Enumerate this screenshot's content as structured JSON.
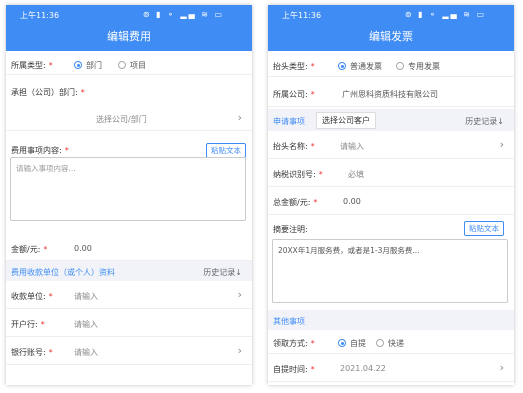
{
  "status_bar": {
    "time": "上午11:36",
    "glyphs": "⊚ ▮ ⚬ ▂▄ ≋ ▭"
  },
  "left": {
    "title": "编辑费用",
    "category": {
      "label": "所属类型:",
      "options": [
        "部门",
        "项目"
      ],
      "selected": "部门"
    },
    "dept": {
      "label": "承担（公司）部门:",
      "value": "选择公司/部门"
    },
    "cost_content": {
      "label": "费用事项内容:",
      "paste_button": "粘贴文本",
      "placeholder": "请输入事项内容..."
    },
    "amount": {
      "label": "金额/元:",
      "value": "0.00"
    },
    "section": {
      "title": "费用收款单位（或个人）资料",
      "history": "历史记录↓"
    },
    "payee": {
      "label": "收款单位:",
      "placeholder": "请输入"
    },
    "bank": {
      "label": "开户行:",
      "placeholder": "请输入"
    },
    "account": {
      "label": "银行账号:",
      "placeholder": "请输入"
    }
  },
  "right": {
    "title": "编辑发票",
    "header_type": {
      "label": "抬头类型:",
      "options": [
        "普通发票",
        "专用发票"
      ],
      "selected": "普通发票"
    },
    "company": {
      "label": "所属公司:",
      "value": "广州思科资质科技有限公司"
    },
    "tabs": [
      "申请事项",
      "选择公司客户"
    ],
    "history": "历史记录↓",
    "header_name": {
      "label": "抬头名称:",
      "placeholder": "请输入"
    },
    "tax_id": {
      "label": "纳税识别号:",
      "placeholder": "必填"
    },
    "total": {
      "label": "总金额/元:",
      "value": "0.00"
    },
    "summary": {
      "label": "摘要注明:",
      "paste_button": "粘贴文本",
      "text": "20XX年1月服务费，或者是1-3月服务费..."
    },
    "other_section": "其他事项",
    "pickup": {
      "label": "领取方式:",
      "options": [
        "自提",
        "快递"
      ],
      "selected": "自提"
    },
    "pickup_time": {
      "label": "自提时间:",
      "value": "2021.04.22"
    }
  }
}
